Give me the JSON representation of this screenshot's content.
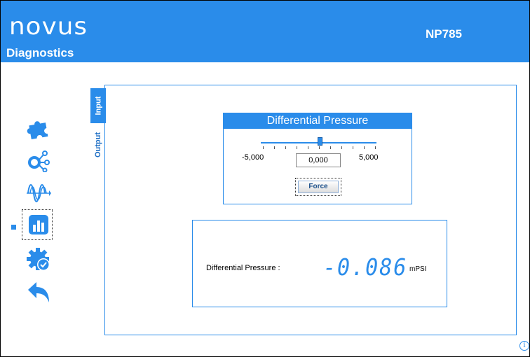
{
  "header": {
    "logo_text": "novus",
    "subtitle": "Diagnostics",
    "model": "NP785"
  },
  "sidebar": {
    "items": [
      {
        "icon": "puzzle-icon",
        "selected": false
      },
      {
        "icon": "network-nodes-icon",
        "selected": false
      },
      {
        "icon": "signal-wave-icon",
        "selected": false
      },
      {
        "icon": "bar-chart-icon",
        "selected": true
      },
      {
        "icon": "gear-check-icon",
        "selected": false
      },
      {
        "icon": "back-arrow-icon",
        "selected": false
      }
    ]
  },
  "tabs": {
    "input_label": "Input",
    "output_label": "Output",
    "active": "Input"
  },
  "differential_pressure": {
    "title": "Differential Pressure",
    "min_label": "-5,000",
    "max_label": "5,000",
    "value": "0,000",
    "force_label": "Force"
  },
  "reading": {
    "label": "Differential Pressure :",
    "value": "-0.086",
    "unit": "mPSI"
  },
  "info_icon": "i",
  "colors": {
    "accent": "#2a8cea"
  }
}
